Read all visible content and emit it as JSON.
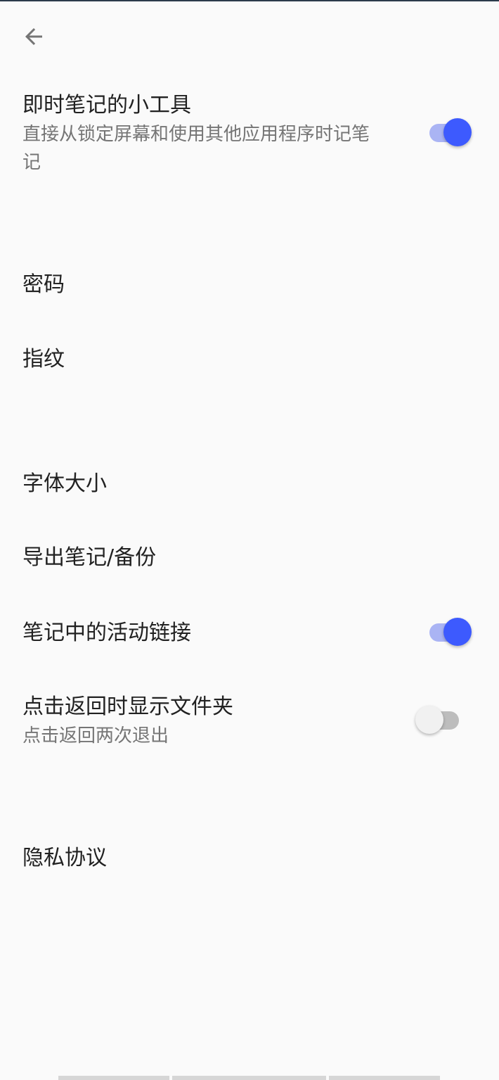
{
  "header": {
    "back_icon": "arrow-left-icon"
  },
  "settings": {
    "widget": {
      "title": "即时笔记的小工具",
      "subtitle": "直接从锁定屏幕和使用其他应用程序时记笔记",
      "enabled": true
    },
    "password": {
      "title": "密码"
    },
    "fingerprint": {
      "title": "指纹"
    },
    "font_size": {
      "title": "字体大小"
    },
    "export": {
      "title": "导出笔记/备份"
    },
    "active_links": {
      "title": "笔记中的活动链接",
      "enabled": true
    },
    "show_folder": {
      "title": "点击返回时显示文件夹",
      "subtitle": "点击返回两次退出",
      "enabled": false
    },
    "privacy": {
      "title": "隐私协议"
    }
  },
  "colors": {
    "accent": "#3d5afe",
    "accent_track": "#aab4f4",
    "background": "#fafafa",
    "text_primary": "#212121",
    "text_secondary": "#757575"
  }
}
